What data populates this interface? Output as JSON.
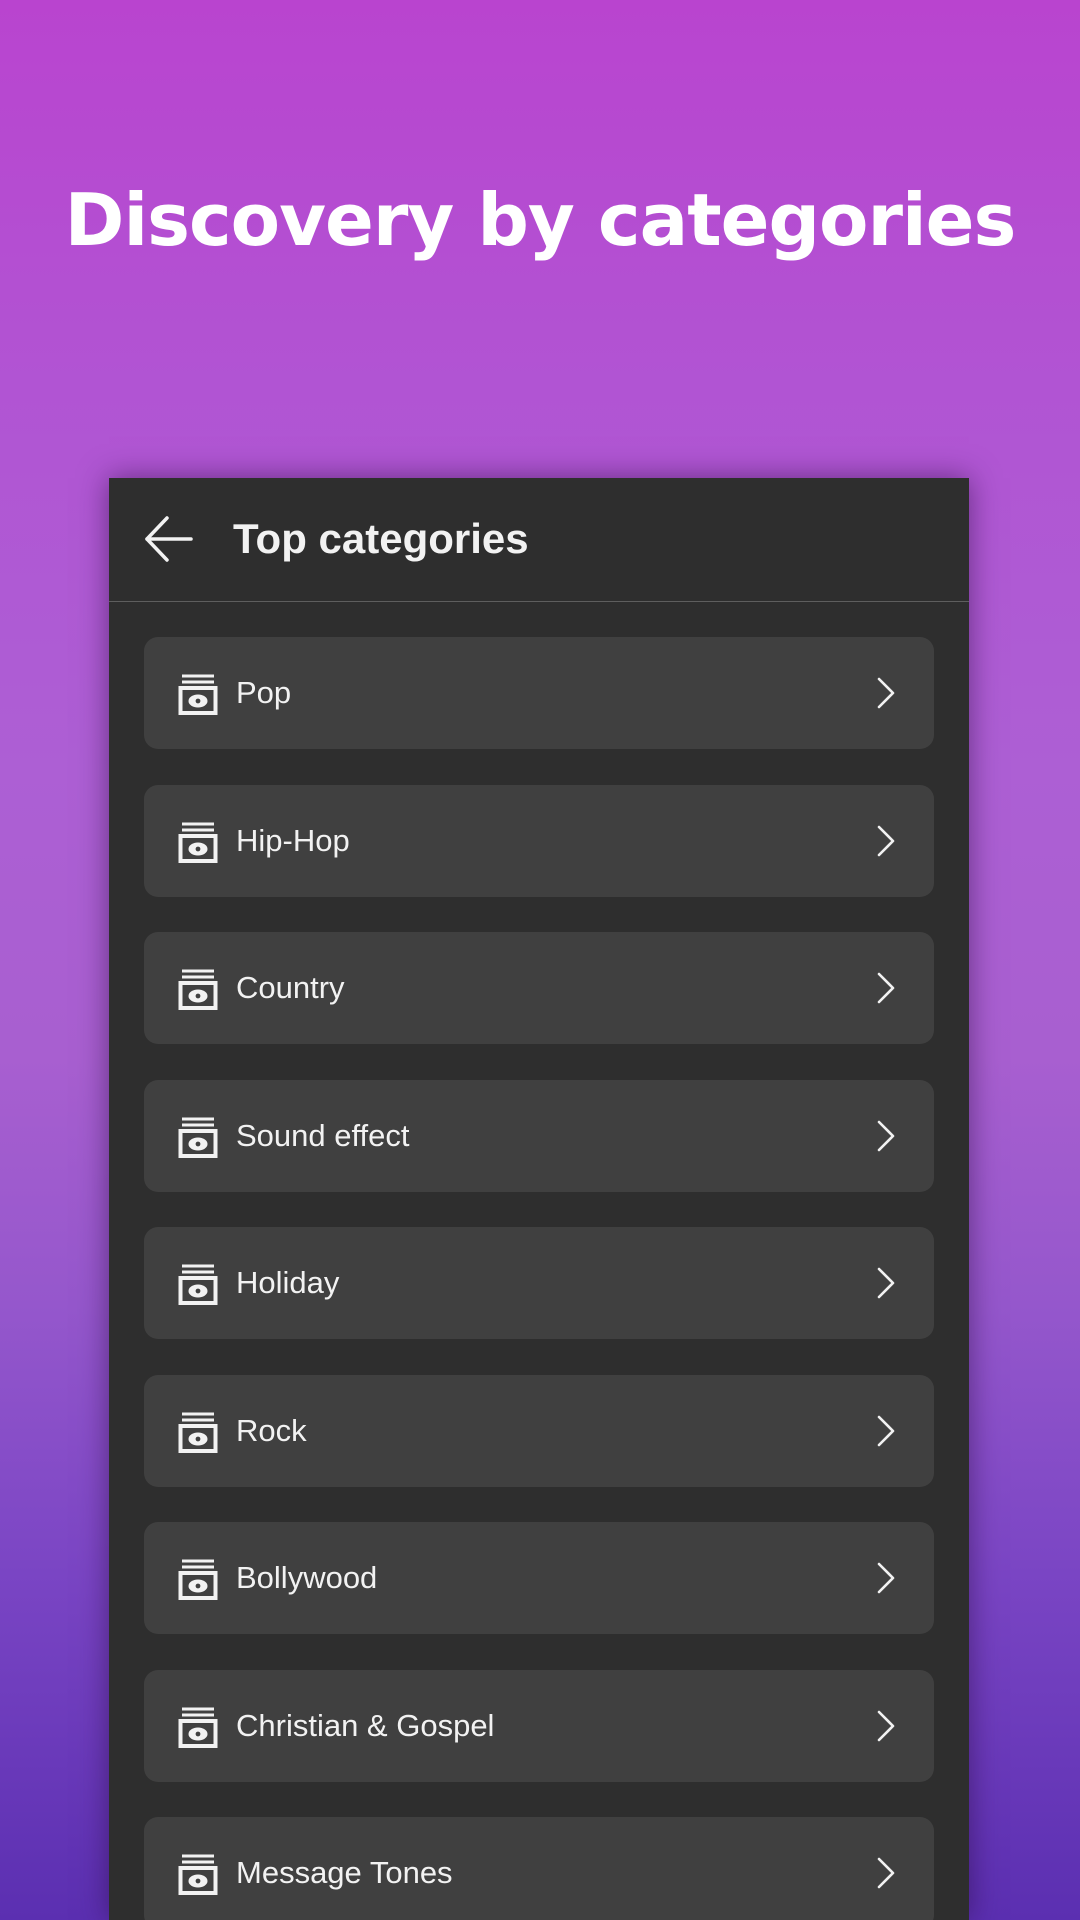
{
  "headline": "Discovery by categories",
  "appbar": {
    "title": "Top categories"
  },
  "categories": [
    {
      "label": "Pop"
    },
    {
      "label": "Hip-Hop"
    },
    {
      "label": "Country"
    },
    {
      "label": "Sound effect"
    },
    {
      "label": "Holiday"
    },
    {
      "label": "Rock"
    },
    {
      "label": "Bollywood"
    },
    {
      "label": "Christian & Gospel"
    },
    {
      "label": "Message Tones"
    }
  ],
  "icons": {
    "back": "back-arrow-icon",
    "category": "music-album-icon",
    "row_action": "chevron-right-icon"
  },
  "colors": {
    "background_top": "#b944cf",
    "background_bottom": "#5b2fb1",
    "panel": "#2e2e2e",
    "row": "#404040",
    "text": "#f2f2f2"
  }
}
